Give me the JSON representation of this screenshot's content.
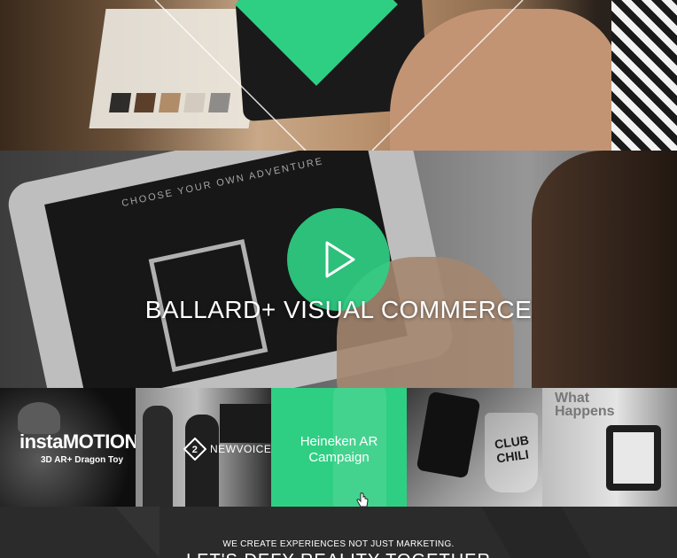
{
  "hero": {
    "screen_title": "CHOOSE YOUR OWN ADVENTURE",
    "title": "BALLARD+ VISUAL COMMERCE",
    "play_icon": "play-icon"
  },
  "tiles": [
    {
      "logo": "instaMOTION",
      "subtitle": "3D AR+ Dragon Toy"
    },
    {
      "logo": "NEWVOICE"
    },
    {
      "caption_line1": "Heineken AR",
      "caption_line2": "Campaign"
    },
    {
      "label": "CLUB CHILI"
    },
    {
      "label_line1": "What",
      "label_line2": "Happens"
    }
  ],
  "footer": {
    "tagline": "WE CREATE EXPERIENCES NOT JUST MARKETING.",
    "headline": "LET'S DEFY REALITY TOGETHER"
  },
  "colors": {
    "accent": "#2fcf83",
    "dark": "#2b2b2b",
    "white": "#ffffff"
  }
}
